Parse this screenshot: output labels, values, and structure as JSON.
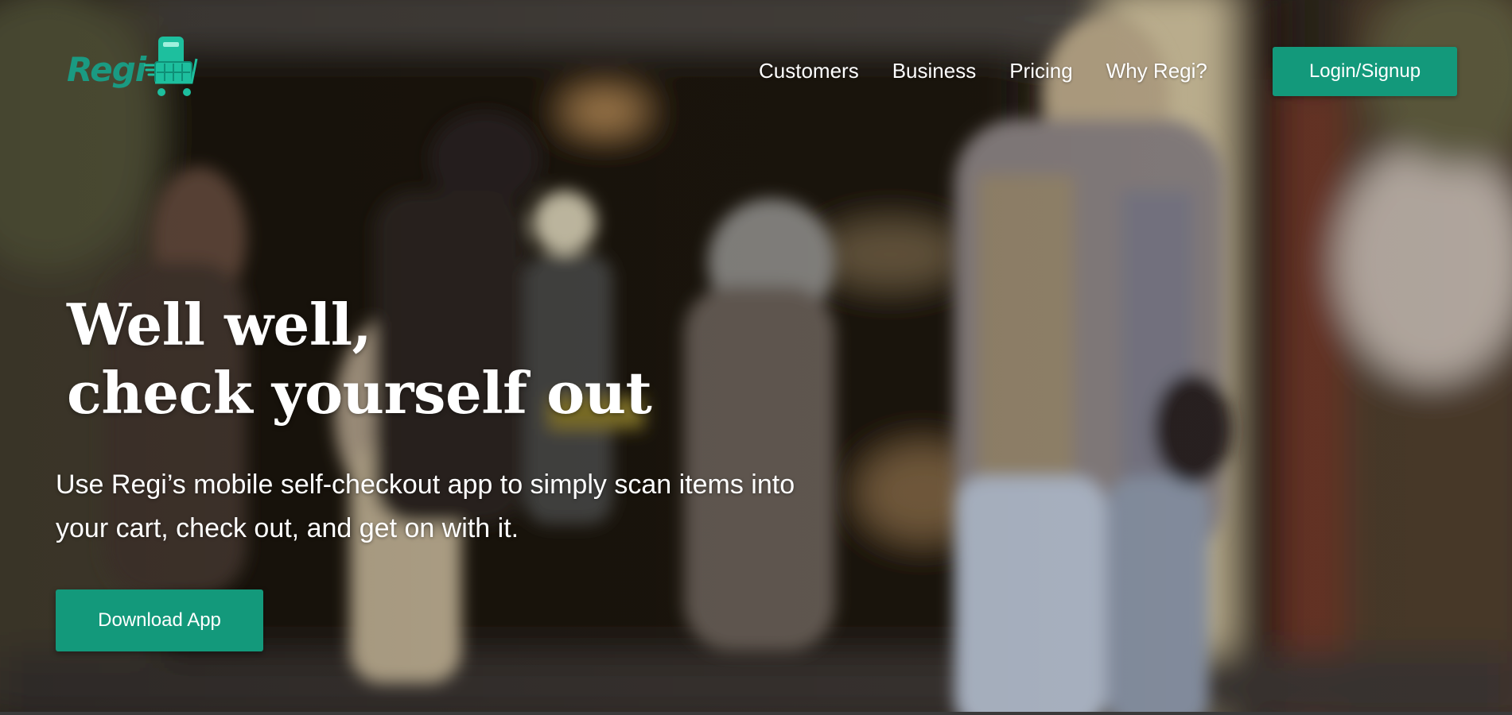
{
  "brand": {
    "name": "Regi",
    "icon": "phone-shopping-cart-icon",
    "color": "#1a9a82"
  },
  "nav": {
    "items": [
      {
        "label": "Customers"
      },
      {
        "label": "Business"
      },
      {
        "label": "Pricing"
      },
      {
        "label": "Why Regi?"
      }
    ],
    "login_label": "Login/Signup"
  },
  "hero": {
    "headline_line1": "Well well,",
    "headline_line2": "check yourself out",
    "subtitle": "Use Regi’s mobile self-checkout app to simply scan items into your cart, check out, and get on with it.",
    "cta_label": "Download App",
    "background": "blurred-store-entrance-photo"
  },
  "colors": {
    "accent": "#13997b",
    "text": "#ffffff"
  }
}
